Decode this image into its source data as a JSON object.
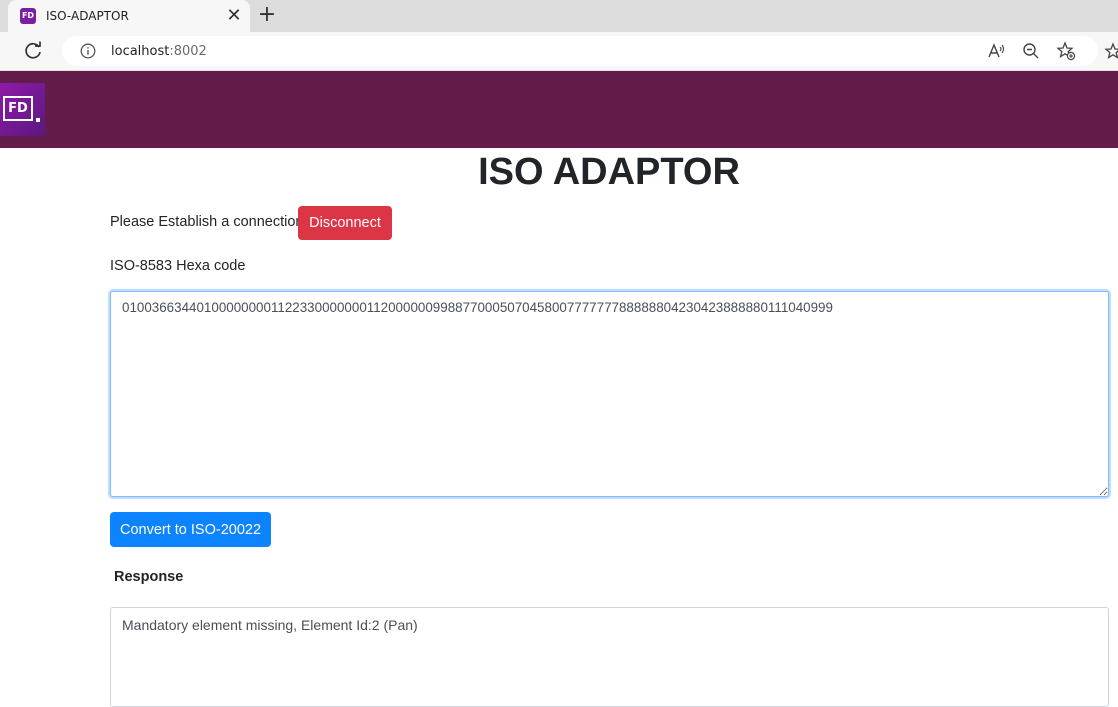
{
  "browser": {
    "tab_title": "ISO-ADAPTOR",
    "tab_favicon_text": "FD",
    "close_glyph": "✕",
    "new_tab_glyph": "+",
    "url_host": "localhost",
    "url_port": ":8002"
  },
  "header": {
    "logo_text": "FD",
    "band_color": "#631b49"
  },
  "page": {
    "title": "ISO ADAPTOR",
    "connection_label": "Please Establish a connection",
    "disconnect_label": "Disconnect",
    "hex_label": "ISO-8583 Hexa code",
    "hex_value": "010036634401000000001122330000000112000000998877000507045800777777788888804230423888880111040999",
    "convert_label": "Convert to ISO-20022",
    "response_label": "Response",
    "response_value": "Mandatory element missing, Element Id:2 (Pan)"
  },
  "colors": {
    "danger": "#dc3545",
    "primary": "#0d84ff"
  },
  "icons": [
    "reload-icon",
    "info-icon",
    "read-aloud-icon",
    "zoom-out-icon",
    "add-favorite-icon",
    "favorites-icon"
  ]
}
